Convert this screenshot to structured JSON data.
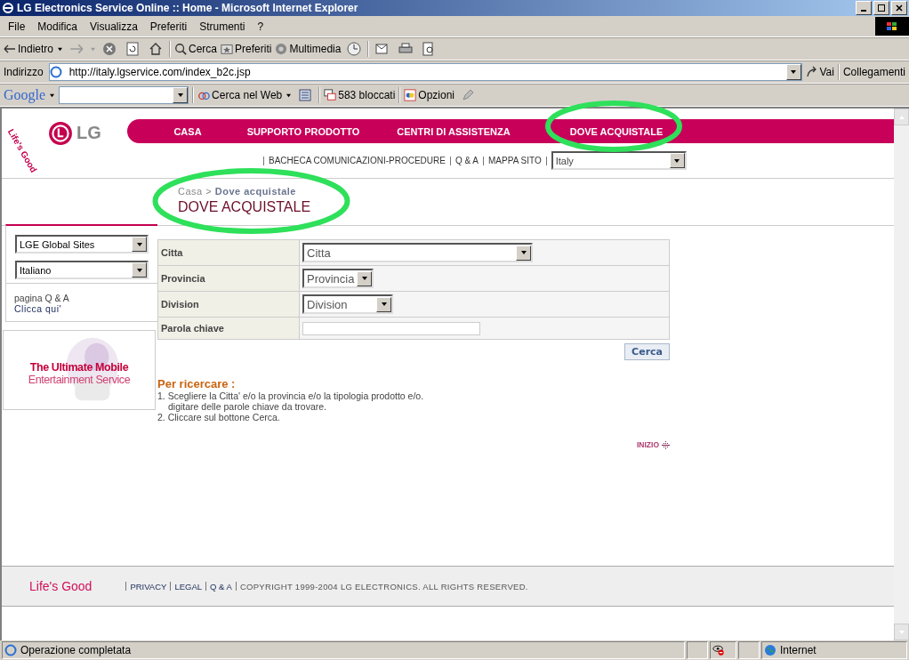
{
  "window": {
    "title": "LG Electronics Service Online :: Home - Microsoft Internet Explorer"
  },
  "menu": [
    "File",
    "Modifica",
    "Visualizza",
    "Preferiti",
    "Strumenti",
    "?"
  ],
  "toolbar": {
    "back": "Indietro",
    "search": "Cerca",
    "favorites": "Preferiti",
    "media": "Multimedia"
  },
  "address_bar": {
    "label": "Indirizzo",
    "url": "http://italy.lgservice.com/index_b2c.jsp",
    "go": "Vai",
    "links": "Collegamenti"
  },
  "google_bar": {
    "logo": "Google",
    "search_web": "Cerca nel Web",
    "blocked": "583 bloccati",
    "options": "Opzioni"
  },
  "page": {
    "logo": {
      "brand": "LG",
      "slogan": "Life's Good"
    },
    "nav": [
      "CASA",
      "SUPPORTO PRODOTTO",
      "CENTRI DI ASSISTENZA",
      "DOVE ACQUISTALE"
    ],
    "sub_nav": [
      "BACHECA COMUNICAZIONI-PROCEDURE",
      "Q & A",
      "MAPPA SITO"
    ],
    "country_select": "Italy",
    "breadcrumb": {
      "home": "Casa",
      "sep": ">",
      "current": "Dove acquistale"
    },
    "heading": "DOVE ACQUISTALE",
    "sidebar": {
      "sites_select": "LGE Global Sites",
      "language_select": "Italiano",
      "qa_text": "pagina Q & A",
      "qa_link": "Clicca qui'",
      "banner": {
        "line1": "The Ultimate Mobile",
        "line2": "Entertainment Service"
      }
    },
    "form": [
      {
        "label": "Citta",
        "kind": "select",
        "value": "Citta"
      },
      {
        "label": "Provincia",
        "kind": "select",
        "value": "Provincia"
      },
      {
        "label": "Division",
        "kind": "select",
        "value": "Division"
      },
      {
        "label": "Parola chiave",
        "kind": "text"
      }
    ],
    "search_button": "Cerca",
    "help": {
      "title": "Per ricercare :",
      "steps": [
        "1. Scegliere la Citta' e/o la provincia e/o la tipologia prodotto e/o.",
        "digitare delle parole chiave da trovare.",
        "2. Cliccare sul bottone Cerca."
      ]
    },
    "top_link": "INIZIO",
    "footer": {
      "slogan": "Life's Good",
      "links": [
        "PRIVACY",
        "LEGAL",
        "Q & A"
      ],
      "copyright": "COPYRIGHT 1999-2004 LG ELECTRONICS. ALL RIGHTS RESERVED."
    }
  },
  "status_bar": {
    "message": "Operazione completata",
    "zone": "Internet"
  }
}
